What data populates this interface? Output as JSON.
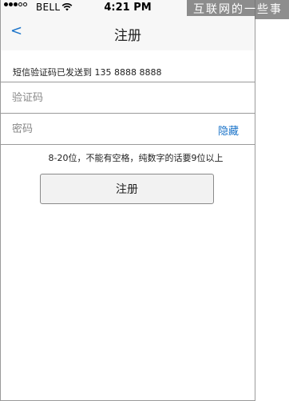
{
  "status_bar": {
    "carrier": "BELL",
    "time": "4:21 PM",
    "signal_bars_filled": 3,
    "signal_bars_total": 5
  },
  "watermark": {
    "text": "互联网的一些事"
  },
  "nav": {
    "back_label": "<",
    "title": "注册"
  },
  "form": {
    "sms_notice": "短信验证码已发送到 135 8888 8888",
    "code_placeholder": "验证码",
    "password_placeholder": "密码",
    "hide_label": "隐藏",
    "hint": "8-20位，不能有空格，纯数字的话要9位以上",
    "submit_label": "注册"
  },
  "colors": {
    "link": "#1a73c9",
    "border": "#9a9a9a",
    "nav_bg": "#f7f7f7"
  }
}
